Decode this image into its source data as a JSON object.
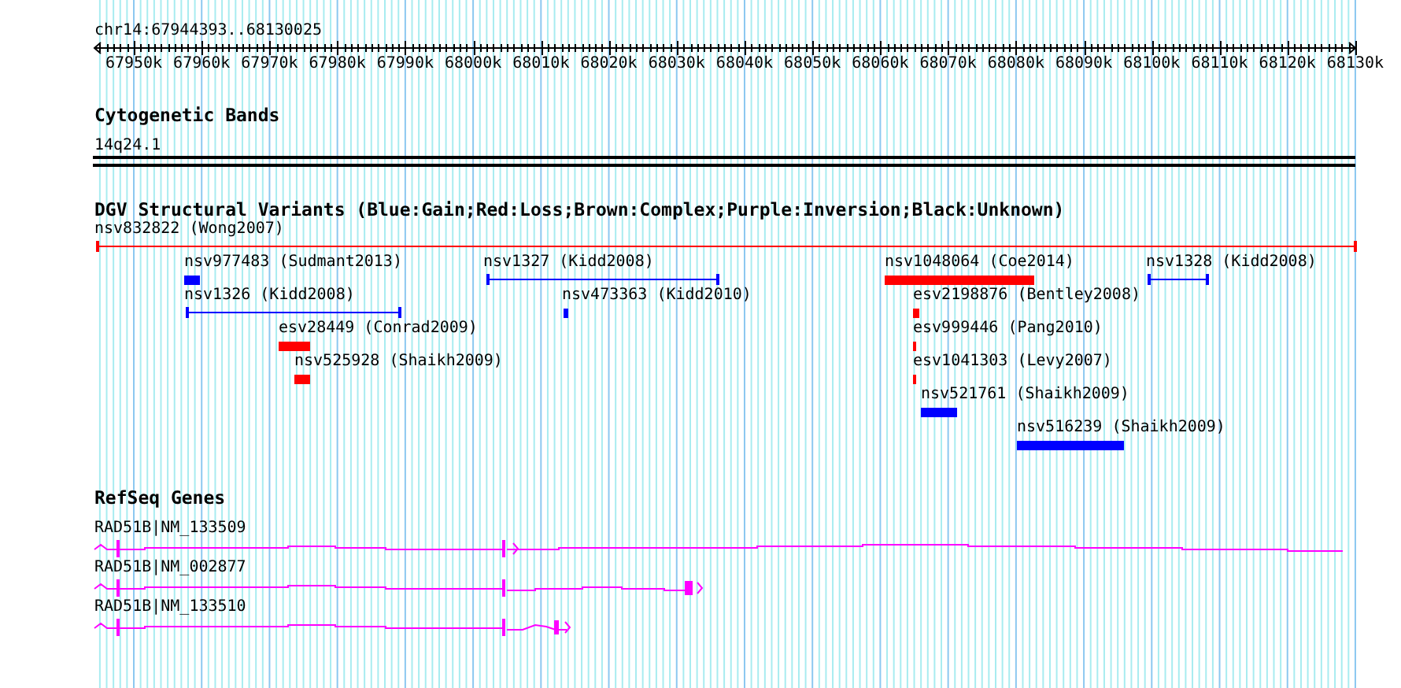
{
  "locus": "chr14:67944393..68130025",
  "ruler": {
    "ticks": [
      "67950k",
      "67960k",
      "67970k",
      "67980k",
      "67990k",
      "68000k",
      "68010k",
      "68020k",
      "68030k",
      "68040k",
      "68050k",
      "68060k",
      "68070k",
      "68080k",
      "68090k",
      "68100k",
      "68110k",
      "68120k",
      "68130k"
    ]
  },
  "cytogenetic_bands": {
    "title": "Cytogenetic Bands",
    "band": "14q24.1"
  },
  "dgv": {
    "title": "DGV Structural Variants (Blue:Gain;Red:Loss;Brown:Complex;Purple:Inversion;Black:Unknown)",
    "variants": [
      {
        "label": "nsv832822 (Wong2007)",
        "color": "#ff0000",
        "kind": "span"
      },
      {
        "label": "nsv977483 (Sudmant2013)",
        "color": "#0000ff",
        "kind": "block"
      },
      {
        "label": "nsv1327 (Kidd2008)",
        "color": "#0000ff",
        "kind": "span"
      },
      {
        "label": "nsv1048064 (Coe2014)",
        "color": "#ff0000",
        "kind": "block"
      },
      {
        "label": "nsv1328 (Kidd2008)",
        "color": "#0000ff",
        "kind": "span"
      },
      {
        "label": "nsv1326 (Kidd2008)",
        "color": "#0000ff",
        "kind": "span"
      },
      {
        "label": "nsv473363 (Kidd2010)",
        "color": "#0000ff",
        "kind": "block"
      },
      {
        "label": "esv2198876 (Bentley2008)",
        "color": "#ff0000",
        "kind": "block"
      },
      {
        "label": "esv28449 (Conrad2009)",
        "color": "#ff0000",
        "kind": "block"
      },
      {
        "label": "esv999446 (Pang2010)",
        "color": "#ff0000",
        "kind": "block"
      },
      {
        "label": "nsv525928 (Shaikh2009)",
        "color": "#ff0000",
        "kind": "block"
      },
      {
        "label": "esv1041303 (Levy2007)",
        "color": "#ff0000",
        "kind": "block"
      },
      {
        "label": "nsv521761 (Shaikh2009)",
        "color": "#0000ff",
        "kind": "block"
      },
      {
        "label": "nsv516239 (Shaikh2009)",
        "color": "#0000ff",
        "kind": "block"
      }
    ]
  },
  "refseq": {
    "title": "RefSeq Genes",
    "genes": [
      {
        "label": "RAD51B|NM_133509"
      },
      {
        "label": "RAD51B|NM_002877"
      },
      {
        "label": "RAD51B|NM_133510"
      }
    ]
  }
}
